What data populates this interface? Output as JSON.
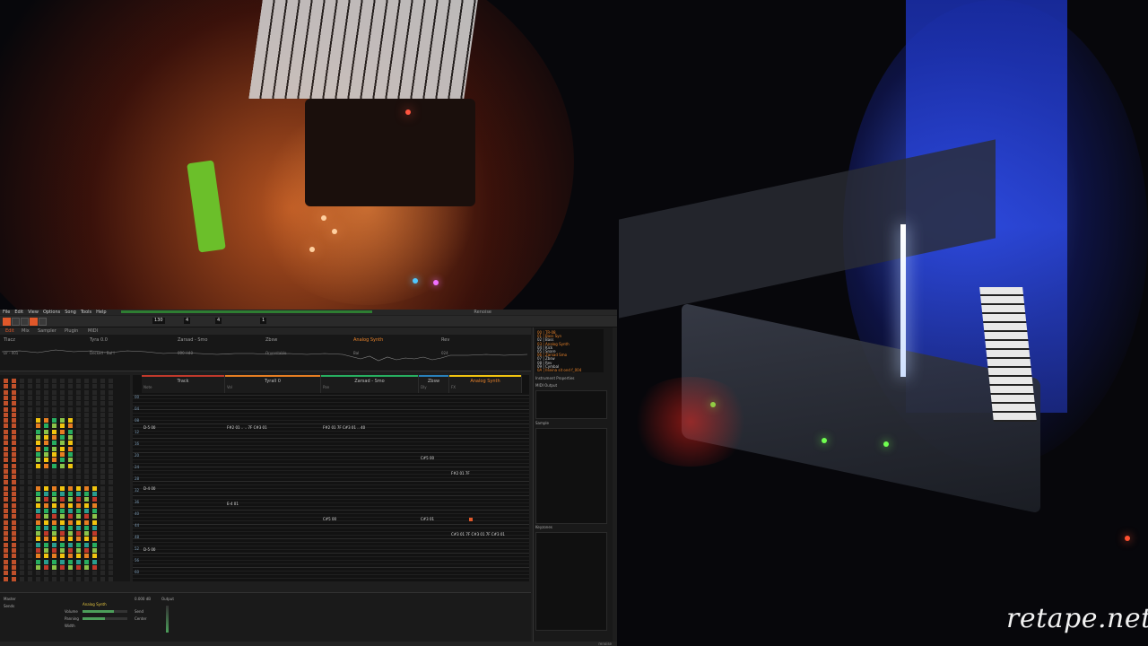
{
  "watermark": "retape.net",
  "daw": {
    "menu": [
      "File",
      "Edit",
      "View",
      "Options",
      "Song",
      "Tools",
      "Help"
    ],
    "window_title": "Renoise",
    "toolbar": {
      "bpm": "130",
      "lpb": "4",
      "octave": "4",
      "step": "1",
      "edit_step": "0"
    },
    "tabs": [
      "Edit",
      "Mix",
      "Sampler",
      "Plugin",
      "MIDI"
    ],
    "track_scopes": [
      "Tlacz",
      "Tyra 0.0",
      "Zarsad - Smo",
      "Zbsw",
      "Analog Synth",
      "Rev"
    ],
    "scope_values": [
      "Dr - 001",
      "Decked - Bal l",
      "000 H40",
      "Orverstable",
      "Bal",
      "024"
    ],
    "pattern_tracks": [
      {
        "name": "Track",
        "color": "#c0392b"
      },
      {
        "name": "Tyrall 0",
        "color": "#e67e22"
      },
      {
        "name": "Zarsad - Smo",
        "color": "#27ae60"
      },
      {
        "name": "Zbsw",
        "color": "#2980b9"
      },
      {
        "name": "Analog Synth",
        "color": "#f1c40f"
      }
    ],
    "column_labels": [
      "Note",
      "Vol",
      "Pan",
      "Dly",
      "FX"
    ],
    "row_labels": [
      "00",
      "04",
      "08",
      "12",
      "16",
      "20",
      "24",
      "28",
      "32",
      "36",
      "40",
      "44",
      "48",
      "52",
      "56",
      "60"
    ],
    "pattern_notes": [
      {
        "row": 4,
        "text": "D-5 00"
      },
      {
        "row": 4,
        "text": "F#2 01 .. .. 7F C#3 01"
      },
      {
        "row": 4,
        "text": "F#2 01 7F C#3 01 .. 40"
      },
      {
        "row": 8,
        "text": "C#5 00"
      },
      {
        "row": 10,
        "text": "F#2 01 7F"
      },
      {
        "row": 12,
        "text": "D-4 00"
      },
      {
        "row": 14,
        "text": "E-4 01"
      },
      {
        "row": 16,
        "text": "C#5 00"
      },
      {
        "row": 16,
        "text": "C#3 01"
      },
      {
        "row": 18,
        "text": "C#3 01 7F C#3 01 7F C#3 01"
      },
      {
        "row": 20,
        "text": "D-5 00"
      }
    ],
    "instruments": [
      {
        "label": "00 | TR-08",
        "hl": true
      },
      {
        "label": "01 | Bass Syn",
        "hl": true
      },
      {
        "label": "02 | Bass",
        "hl": false
      },
      {
        "label": "03 | Analog Synth",
        "hl": true
      },
      {
        "label": "04 | Kick",
        "hl": false
      },
      {
        "label": "05 | Snare",
        "hl": false
      },
      {
        "label": "06 | Zarsad Smo",
        "hl": true
      },
      {
        "label": "07 | Zbsw",
        "hl": false
      },
      {
        "label": "08 | Rev",
        "hl": false
      },
      {
        "label": "09 | Cymbal",
        "hl": false
      },
      {
        "label": "0A | Ilseina sit ond f_004",
        "hl": true
      }
    ],
    "right_sections": [
      "Instrument Properties",
      "MIDI Output",
      "Sample",
      "Keyzones",
      "Modulation"
    ],
    "bottom_items": [
      "Master",
      "Sends",
      "Analog Synth",
      "Volume",
      "Panning",
      "Width",
      "Send",
      "Output",
      "0.000 dB",
      "Center"
    ],
    "status": "renoise"
  }
}
